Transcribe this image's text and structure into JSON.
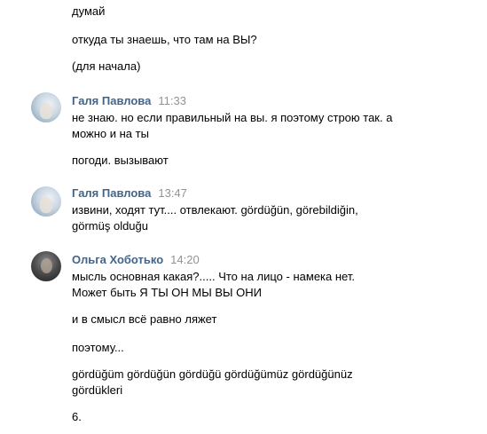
{
  "messages": {
    "prev": {
      "line1": "думай",
      "line2": "откуда ты знаешь, что там на ВЫ?",
      "line3": "(для начала)"
    },
    "m1": {
      "author": "Галя Павлова",
      "time": "11:33",
      "line1": "не знаю. но если правильный на вы. я поэтому строю так. а",
      "line2": "можно и на ты",
      "line3": "погоди. вызывают"
    },
    "m2": {
      "author": "Галя Павлова",
      "time": "13:47",
      "line1": "извини, ходят тут.... отвлекают. gördüğün, görebildiğin,",
      "line2": "görmüş olduğu"
    },
    "m3": {
      "author": "Ольга Хоботько",
      "time": "14:20",
      "line1": "мысль основная какая?..... Что на лицо - намека нет.",
      "line2": "Может быть Я ТЫ ОН МЫ ВЫ ОНИ",
      "line3": "и в смысл всё равно ляжет",
      "line4": "поэтому...",
      "line5": "gördüğüm gördüğün gördüğü gördüğümüz gördüğünüz",
      "line6": "gördükleri",
      "line7": "6."
    }
  },
  "colors": {
    "author": "#42648b",
    "time": "#939393",
    "text": "#000000",
    "background": "#ffffff"
  }
}
